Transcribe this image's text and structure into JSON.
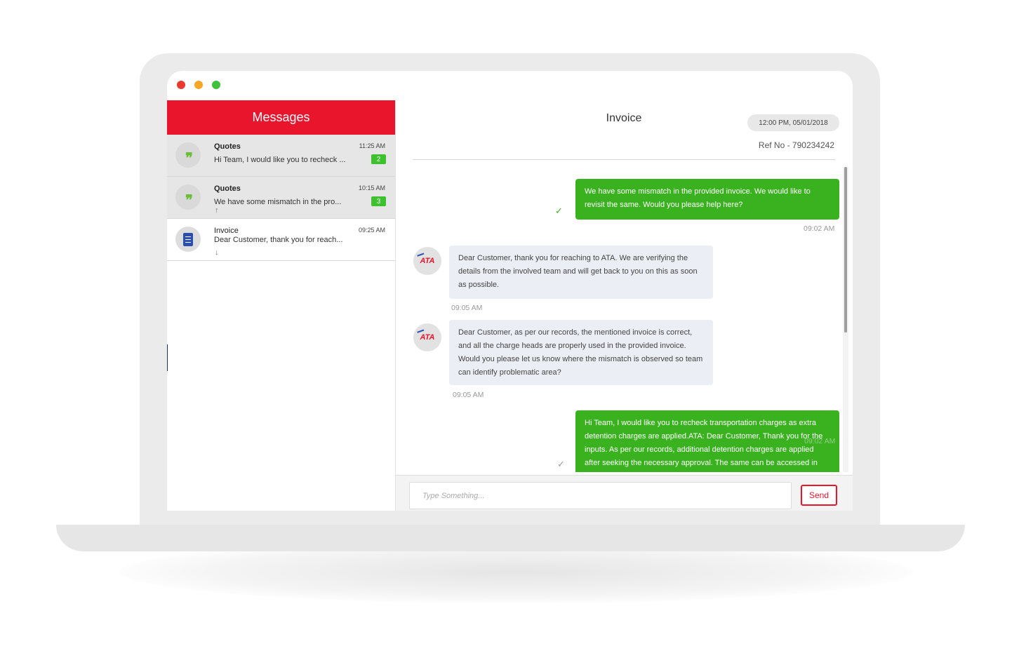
{
  "sidebar": {
    "title": "Messages",
    "conversations": [
      {
        "title": "Quotes",
        "preview": "Hi Team, I would like you to recheck ...",
        "time": "11:25 AM",
        "unread": "2",
        "icon": "quote-icon"
      },
      {
        "title": "Quotes",
        "preview": "We have some mismatch in the pro...",
        "time": "10:15 AM",
        "unread": "3",
        "arrow": "↑",
        "icon": "quote-icon"
      },
      {
        "title": "Invoice",
        "preview": "Dear Customer, thank you for reach...",
        "time": "09:25 AM",
        "arrow": "↓",
        "icon": "document-icon"
      }
    ]
  },
  "chat": {
    "title": "Invoice",
    "date": "12:00 PM, 05/01/2018",
    "ref": "Ref No - 790234242",
    "messages": [
      {
        "direction": "outgoing",
        "text": "We have some mismatch in the provided invoice. We would like to revisit the same. Would you please help here?",
        "time": "09:02 AM",
        "status": "✓"
      },
      {
        "direction": "incoming",
        "avatar": "ATA",
        "text": "Dear Customer, thank you for reaching to ATA. We are verifying the details from the involved team and will get back to you on this as soon as possible.",
        "time": "09:05 AM"
      },
      {
        "direction": "incoming",
        "avatar": "ATA",
        "text": "Dear Customer, as per our records, the mentioned invoice is correct, and all the charge heads are properly used in the provided invoice. Would you please let us know where the mismatch is observed so team can identify problematic area?",
        "time": "09:05 AM"
      },
      {
        "direction": "outgoing",
        "text": "Hi Team, I would like you to recheck transportation charges as extra detention charges are applied.ATA: Dear Customer, Thank you for the inputs. As per our records, additional detention charges are applied after seeking the necessary approval. The same can be accessed in",
        "time": "09:02 AM",
        "status": "✓"
      }
    ],
    "composer": {
      "placeholder": "Type Something...",
      "send_label": "Send"
    }
  },
  "colors": {
    "brand_red": "#e8152c",
    "outgoing_green": "#3ab220",
    "incoming_bg": "#eceef5",
    "badge_green": "#3ec12f"
  }
}
